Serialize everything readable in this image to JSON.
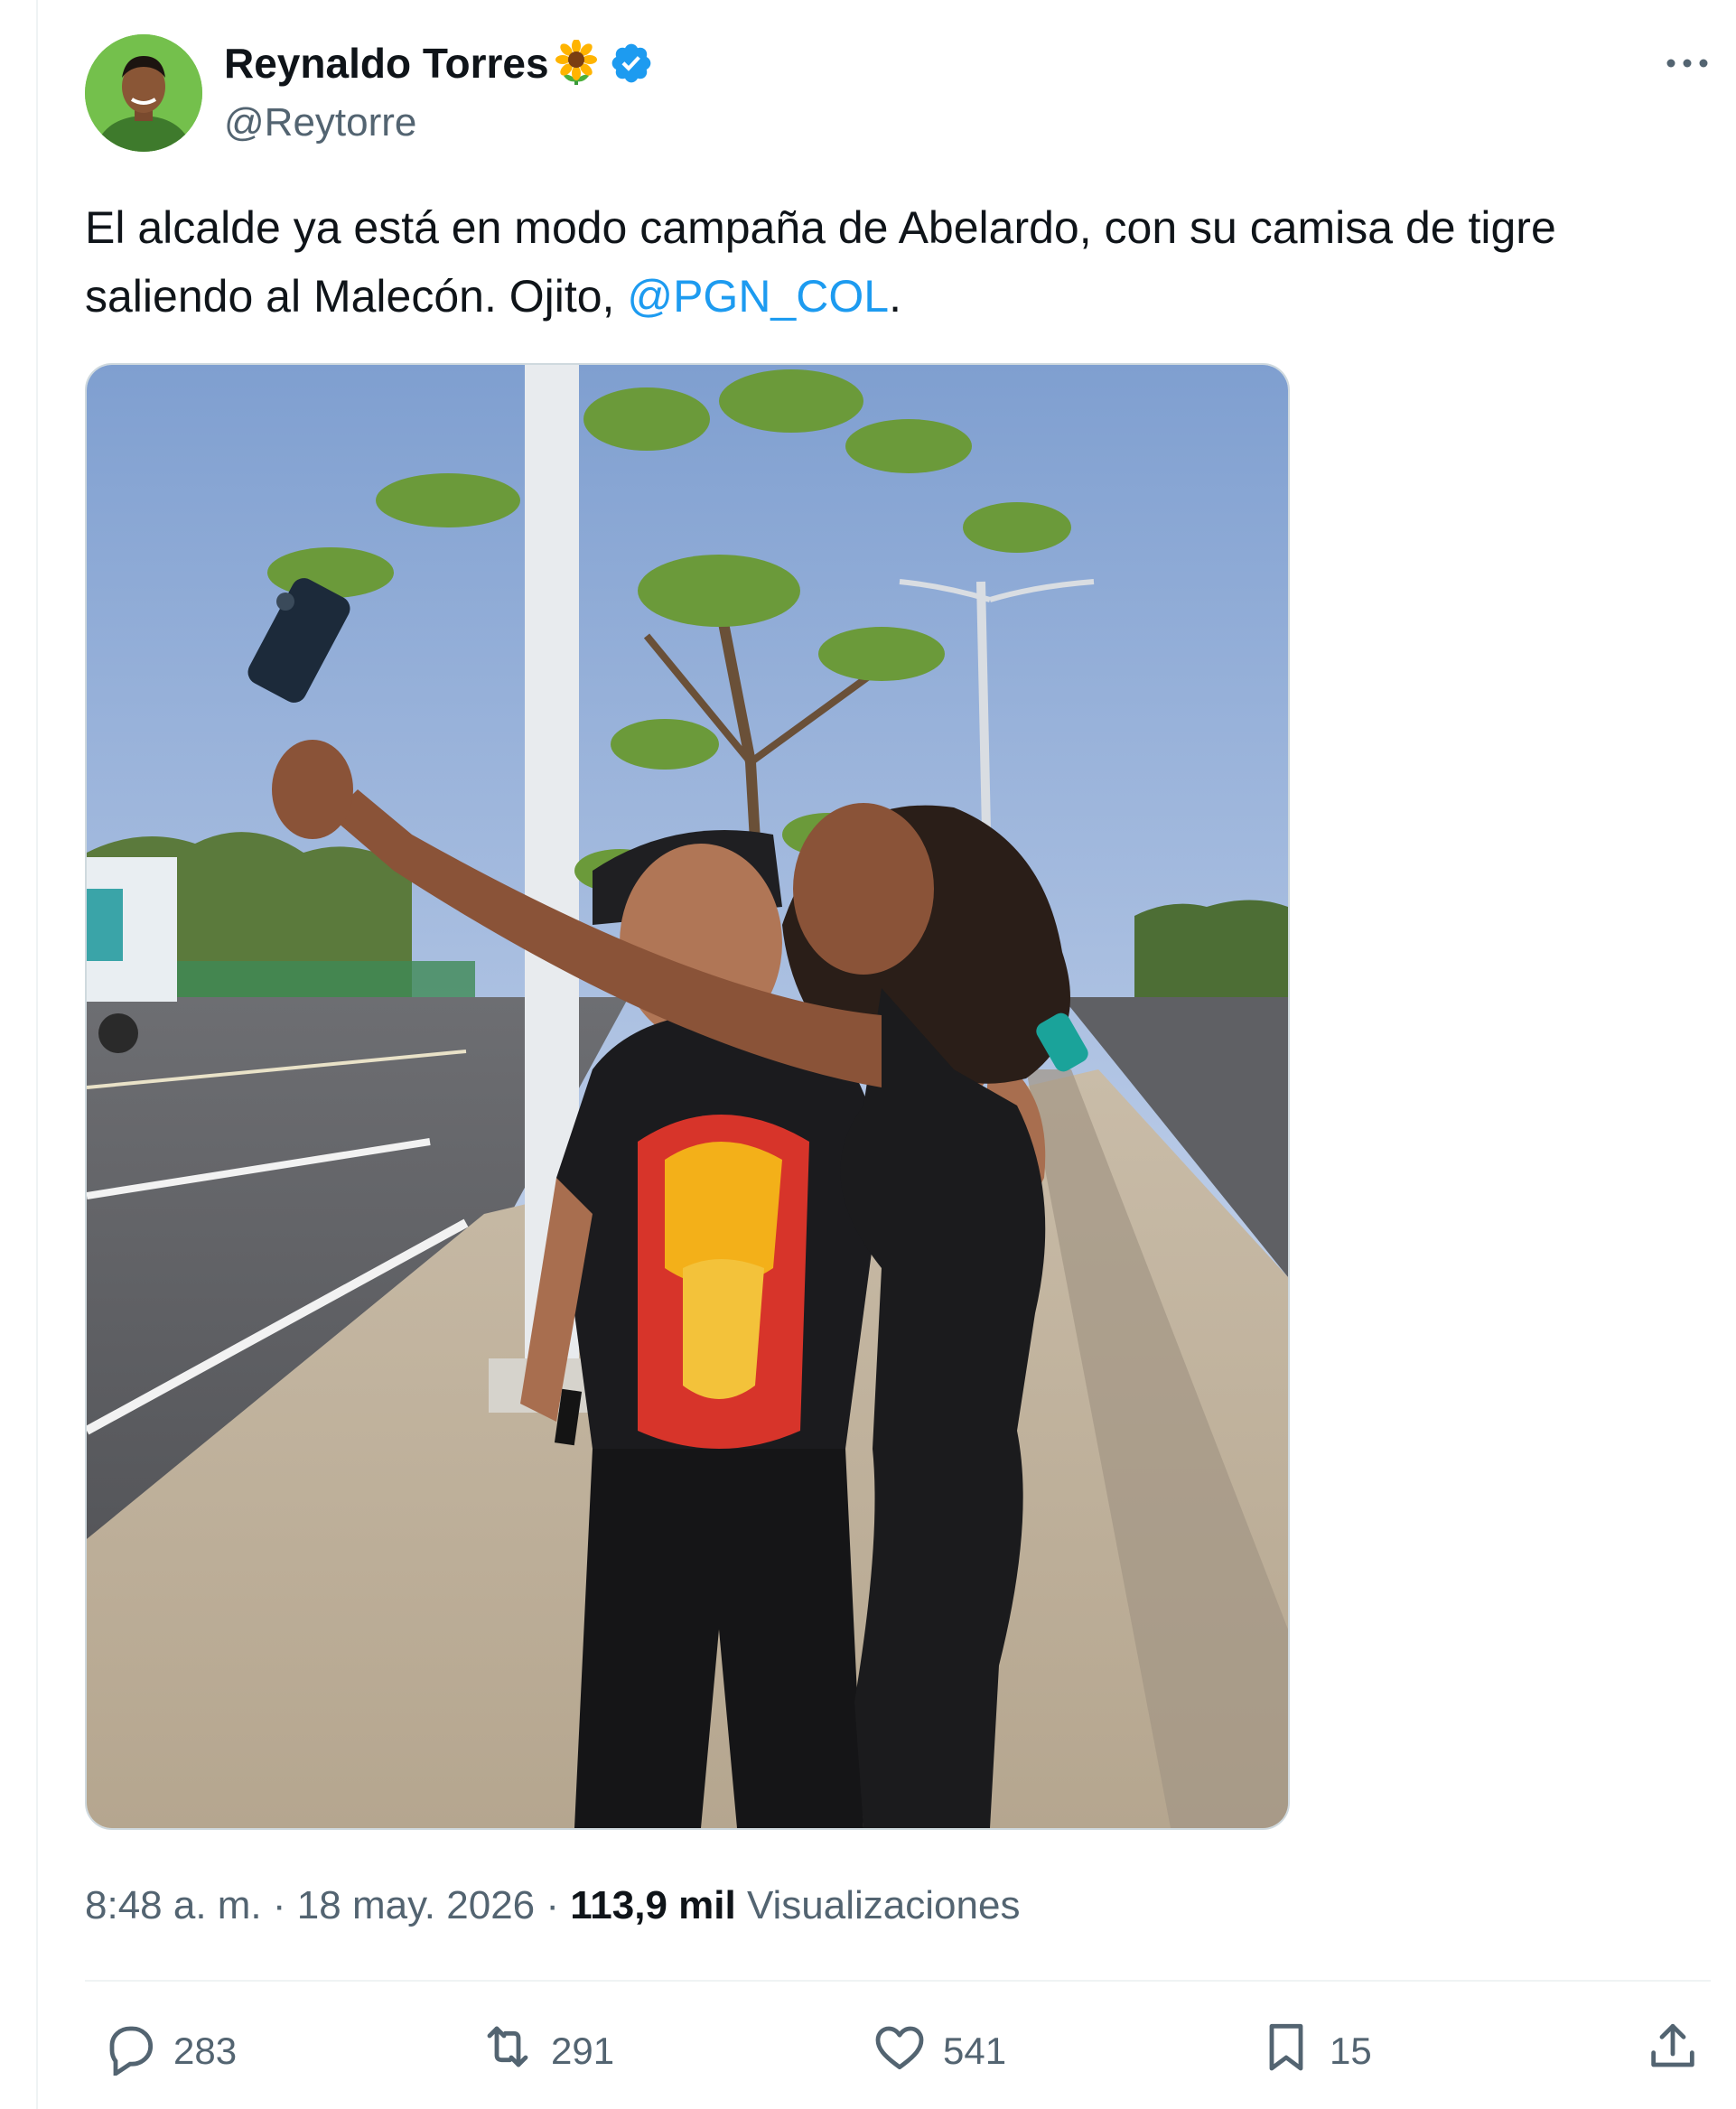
{
  "author": {
    "name": "Reynaldo Torres",
    "handle": "@Reytorre",
    "verified": true
  },
  "tweet": {
    "text_before": "El alcalde ya está en modo campaña de Abelardo, con su camisa de tigre saliendo al Malecón. Ojito, ",
    "mention": "@PGN_COL",
    "text_after": "."
  },
  "meta": {
    "time": "8:48 a. m.",
    "separator": " · ",
    "date": "18 may. 2026",
    "views_count": "113,9 mil",
    "views_label": "Visualizaciones"
  },
  "actions": {
    "replies": "283",
    "reposts": "291",
    "likes": "541",
    "bookmarks": "15"
  },
  "icons": [
    "sunflower-emoji",
    "verified-badge-icon",
    "more-options-icon",
    "reply-icon",
    "repost-icon",
    "like-icon",
    "bookmark-icon",
    "share-icon"
  ],
  "colors": {
    "accent": "#1d9bf0",
    "secondary_text": "#536471",
    "primary_text": "#0f1419"
  }
}
